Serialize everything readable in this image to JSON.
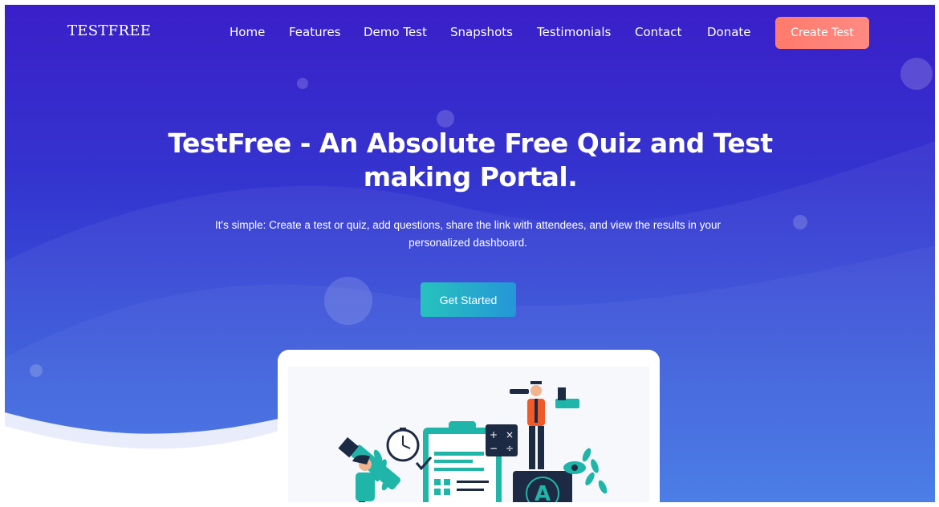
{
  "brand": "TESTFREE",
  "nav": {
    "items": [
      "Home",
      "Features",
      "Demo Test",
      "Snapshots",
      "Testimonials",
      "Contact",
      "Donate"
    ],
    "cta": "Create Test"
  },
  "hero": {
    "title": "TestFree - An Absolute Free Quiz and Test making Portal.",
    "subtitle": "It's simple: Create a test or quiz, add questions, share the link with attendees, and view the results in your personalized dashboard.",
    "cta": "Get Started"
  },
  "colors": {
    "accent_orange": "#ff7a6b",
    "accent_teal": "#26c2bd",
    "bg_top": "#3a1fc8",
    "bg_bottom": "#3a72e4"
  },
  "illustration": {
    "icons": [
      "stopwatch-icon",
      "clipboard-icon",
      "calculator-icon",
      "eye-icon",
      "grade-a-plus-icon",
      "graduate-person",
      "pencil-person"
    ],
    "calculator_symbols": [
      "+",
      "×",
      "−",
      "÷"
    ],
    "grade_label": "A"
  }
}
